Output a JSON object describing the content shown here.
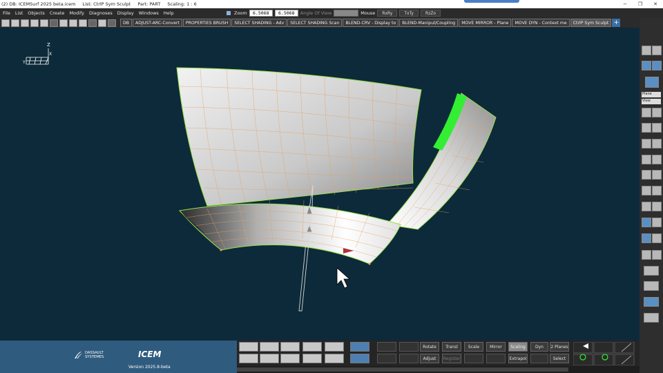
{
  "titlebar": {
    "db": "(2) DB: ICEMSurf 2025 beta.icem",
    "list": "List: CtrlP Sym Sculpt",
    "part": "Part: PART",
    "scaling": "Scaling: 1 : 6",
    "min": "−",
    "max": "❐",
    "close": "✕"
  },
  "menu": [
    "File",
    "List",
    "Objects",
    "Create",
    "Modify",
    "Diagnoses",
    "Display",
    "Windows",
    "Help"
  ],
  "zoom": {
    "label": "Zoom",
    "value1": "6.5068",
    "value2": "6.5068",
    "angle_label": "Angle Of View",
    "mouse_label": "Mouse",
    "btn1": "RxRy",
    "btn2": "TxTy",
    "btn3": "RzZo"
  },
  "tabs": [
    "DB",
    "ADJUST-ARC-Convert",
    "PROPERTIES BRUSH",
    "SELECT SHADING - Adv",
    "SELECT SHADING Scan",
    "BLEND-CRV - Display to",
    "BLEND-Manipul/Coupling",
    "MOVE MIRROR - Plane",
    "MOVE DYN - Context me",
    "CtrlP Sym Sculpt"
  ],
  "tab_add": "+",
  "viewport": {
    "plane_label": "Plane",
    "axis_z": "Z",
    "axis_x": "X",
    "axis_y": "Y"
  },
  "rightpanel": {
    "select1": "Plane",
    "select2": "View"
  },
  "brand": {
    "ds_line1": "DASSAULT",
    "ds_line2": "SYSTEMES",
    "product": "ICEM",
    "version": "Version 2025.8-beta"
  },
  "bottom": {
    "rotate": "Rotate",
    "transl": "Transl",
    "scale": "Scale",
    "mirror": "Mirror",
    "scaling": "Scaling",
    "dyn": "Dyn",
    "two_planes": "2 Planes",
    "adjust": "Adjust",
    "register": "Register",
    "extrapol": "Extrapol",
    "select": "Select"
  },
  "colors": {
    "viewport_bg": "#0d2a3a",
    "brand_bg": "#2f5b7e",
    "highlight_green": "#33ee33"
  }
}
